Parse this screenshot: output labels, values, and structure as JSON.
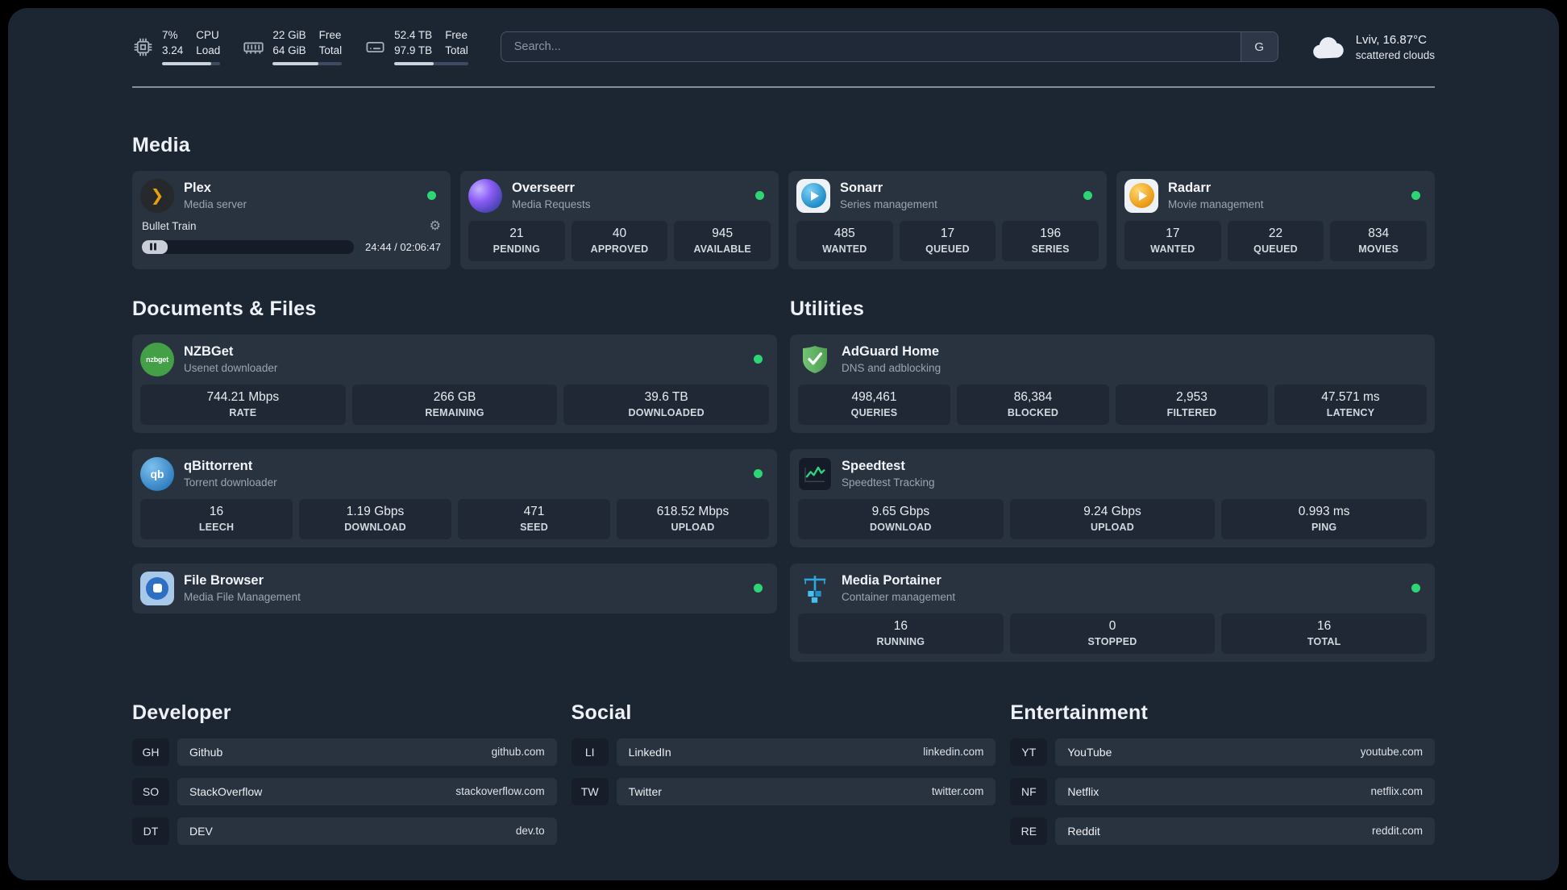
{
  "topbar": {
    "cpu": {
      "value_top": "7%",
      "label_top": "CPU",
      "value_bottom": "3.24",
      "label_bottom": "Load",
      "bar_pct": 85
    },
    "memory": {
      "value_top": "22 GiB",
      "label_top": "Free",
      "value_bottom": "64 GiB",
      "label_bottom": "Total",
      "bar_pct": 66
    },
    "disk": {
      "value_top": "52.4 TB",
      "label_top": "Free",
      "value_bottom": "97.9 TB",
      "label_bottom": "Total",
      "bar_pct": 53
    },
    "search": {
      "placeholder": "Search...",
      "engine_label": "G"
    },
    "weather": {
      "location": "Lviv, 16.87°C",
      "condition": "scattered clouds"
    }
  },
  "media": {
    "title": "Media",
    "plex": {
      "name": "Plex",
      "subtitle": "Media server",
      "now_playing": "Bullet Train",
      "time": "24:44 / 02:06:47",
      "progress_pct": 12
    },
    "overseerr": {
      "name": "Overseerr",
      "subtitle": "Media Requests",
      "stats": [
        {
          "value": "21",
          "label": "PENDING"
        },
        {
          "value": "40",
          "label": "APPROVED"
        },
        {
          "value": "945",
          "label": "AVAILABLE"
        }
      ]
    },
    "sonarr": {
      "name": "Sonarr",
      "subtitle": "Series management",
      "stats": [
        {
          "value": "485",
          "label": "WANTED"
        },
        {
          "value": "17",
          "label": "QUEUED"
        },
        {
          "value": "196",
          "label": "SERIES"
        }
      ]
    },
    "radarr": {
      "name": "Radarr",
      "subtitle": "Movie management",
      "stats": [
        {
          "value": "17",
          "label": "WANTED"
        },
        {
          "value": "22",
          "label": "QUEUED"
        },
        {
          "value": "834",
          "label": "MOVIES"
        }
      ]
    }
  },
  "documents": {
    "title": "Documents & Files",
    "nzbget": {
      "name": "NZBGet",
      "subtitle": "Usenet downloader",
      "stats": [
        {
          "value": "744.21 Mbps",
          "label": "RATE"
        },
        {
          "value": "266 GB",
          "label": "REMAINING"
        },
        {
          "value": "39.6 TB",
          "label": "DOWNLOADED"
        }
      ]
    },
    "qbittorrent": {
      "name": "qBittorrent",
      "subtitle": "Torrent downloader",
      "stats": [
        {
          "value": "16",
          "label": "LEECH"
        },
        {
          "value": "1.19 Gbps",
          "label": "DOWNLOAD"
        },
        {
          "value": "471",
          "label": "SEED"
        },
        {
          "value": "618.52 Mbps",
          "label": "UPLOAD"
        }
      ]
    },
    "filebrowser": {
      "name": "File Browser",
      "subtitle": "Media File Management"
    }
  },
  "utilities": {
    "title": "Utilities",
    "adguard": {
      "name": "AdGuard Home",
      "subtitle": "DNS and adblocking",
      "stats": [
        {
          "value": "498,461",
          "label": "QUERIES"
        },
        {
          "value": "86,384",
          "label": "BLOCKED"
        },
        {
          "value": "2,953",
          "label": "FILTERED"
        },
        {
          "value": "47.571 ms",
          "label": "LATENCY"
        }
      ]
    },
    "speedtest": {
      "name": "Speedtest",
      "subtitle": "Speedtest Tracking",
      "stats": [
        {
          "value": "9.65 Gbps",
          "label": "DOWNLOAD"
        },
        {
          "value": "9.24 Gbps",
          "label": "UPLOAD"
        },
        {
          "value": "0.993 ms",
          "label": "PING"
        }
      ]
    },
    "portainer": {
      "name": "Media Portainer",
      "subtitle": "Container management",
      "stats": [
        {
          "value": "16",
          "label": "RUNNING"
        },
        {
          "value": "0",
          "label": "STOPPED"
        },
        {
          "value": "16",
          "label": "TOTAL"
        }
      ]
    }
  },
  "bookmarks": {
    "developer": {
      "title": "Developer",
      "items": [
        {
          "abbr": "GH",
          "name": "Github",
          "domain": "github.com"
        },
        {
          "abbr": "SO",
          "name": "StackOverflow",
          "domain": "stackoverflow.com"
        },
        {
          "abbr": "DT",
          "name": "DEV",
          "domain": "dev.to"
        }
      ]
    },
    "social": {
      "title": "Social",
      "items": [
        {
          "abbr": "LI",
          "name": "LinkedIn",
          "domain": "linkedin.com"
        },
        {
          "abbr": "TW",
          "name": "Twitter",
          "domain": "twitter.com"
        }
      ]
    },
    "entertainment": {
      "title": "Entertainment",
      "items": [
        {
          "abbr": "YT",
          "name": "YouTube",
          "domain": "youtube.com"
        },
        {
          "abbr": "NF",
          "name": "Netflix",
          "domain": "netflix.com"
        },
        {
          "abbr": "RE",
          "name": "Reddit",
          "domain": "reddit.com"
        }
      ]
    }
  },
  "icons": {
    "plex_glyph": "❯",
    "gear_glyph": "⚙",
    "nzbget_label": "nzbget",
    "qbittorrent_label": "qb"
  },
  "colors": {
    "status_online": "#2ed573",
    "plex_gold": "#e5a00d",
    "speedtest_green": "#2fd27d",
    "background": "#1c2532",
    "card": "#29323f",
    "tile": "#1f2834"
  }
}
